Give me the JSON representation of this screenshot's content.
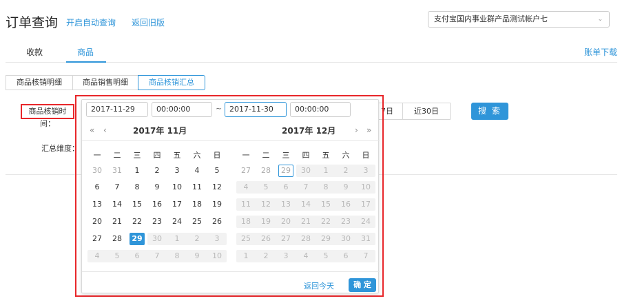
{
  "header": {
    "title": "订单查询",
    "auto_query_link": "开启自动查询",
    "old_version_link": "返回旧版",
    "account_selected": "支付宝国内事业群产品测试帐户七"
  },
  "main_tabs": [
    "收款",
    "商品"
  ],
  "bill_download": "账单下载",
  "sub_tabs": [
    "商品核销明细",
    "商品销售明细",
    "商品核销汇总"
  ],
  "filters": {
    "time_label": "商品核销时间：",
    "dimension_label": "汇总维度：",
    "quick_btn_7": "7日",
    "quick_btn_30": "近30日",
    "search_button": "搜 索"
  },
  "picker": {
    "start_date": "2017-11-29",
    "start_time": "00:00:00",
    "separator": "~",
    "end_date": "2017-11-30",
    "end_time": "00:00:00",
    "nav_prev_year": "«",
    "nav_prev_month": "‹",
    "nav_next_month": "›",
    "nav_next_year": "»",
    "left_month_title": "2017年 11月",
    "right_month_title": "2017年 12月",
    "weekdays": [
      "一",
      "二",
      "三",
      "四",
      "五",
      "六",
      "日"
    ],
    "left_days": [
      [
        "30",
        "31",
        "1",
        "2",
        "3",
        "4",
        "5"
      ],
      [
        "6",
        "7",
        "8",
        "9",
        "10",
        "11",
        "12"
      ],
      [
        "13",
        "14",
        "15",
        "16",
        "17",
        "18",
        "19"
      ],
      [
        "20",
        "21",
        "22",
        "23",
        "24",
        "25",
        "26"
      ],
      [
        "27",
        "28",
        "29",
        "30",
        "1",
        "2",
        "3"
      ],
      [
        "4",
        "5",
        "6",
        "7",
        "8",
        "9",
        "10"
      ]
    ],
    "right_days": [
      [
        "27",
        "28",
        "29",
        "30",
        "1",
        "2",
        "3"
      ],
      [
        "4",
        "5",
        "6",
        "7",
        "8",
        "9",
        "10"
      ],
      [
        "11",
        "12",
        "13",
        "14",
        "15",
        "16",
        "17"
      ],
      [
        "18",
        "19",
        "20",
        "21",
        "22",
        "23",
        "24"
      ],
      [
        "25",
        "26",
        "27",
        "28",
        "29",
        "30",
        "31"
      ],
      [
        "1",
        "2",
        "3",
        "4",
        "5",
        "6",
        "7"
      ]
    ],
    "back_today": "返回今天",
    "confirm": "确 定"
  },
  "colors": {
    "accent": "#2f95d9",
    "highlight_red": "#e8262a",
    "disabled_bg": "#f2f2f2"
  }
}
